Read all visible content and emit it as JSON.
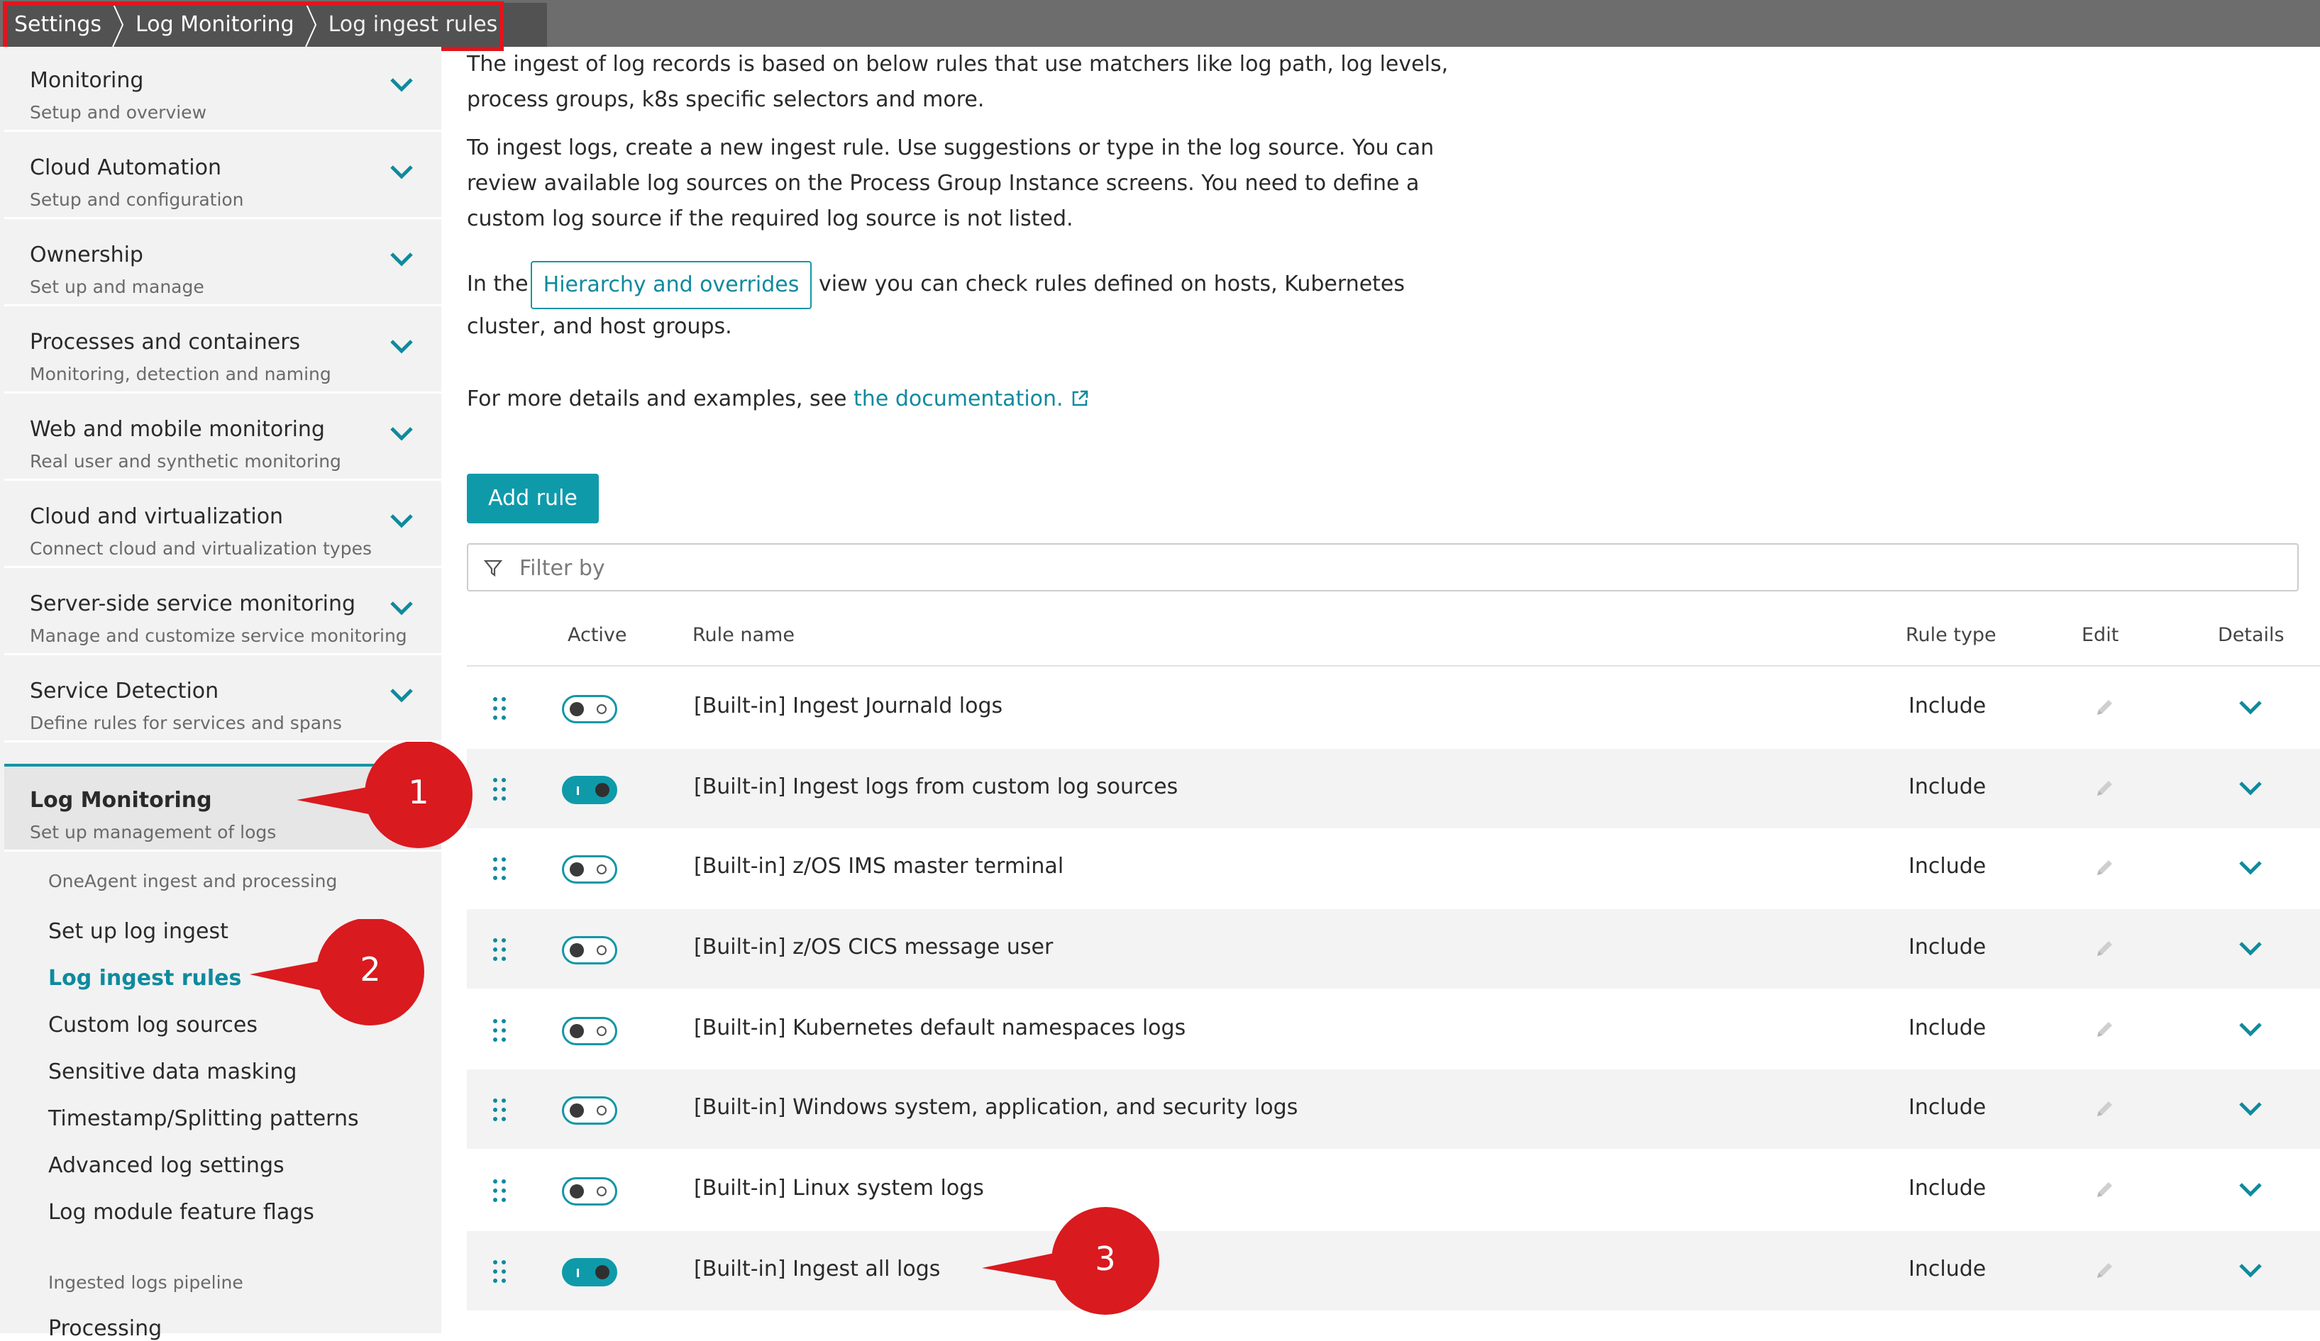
{
  "breadcrumb": [
    "Settings",
    "Log Monitoring",
    "Log ingest rules"
  ],
  "sidebar": {
    "groups": [
      {
        "title": "Monitoring",
        "subtitle": "Setup and overview"
      },
      {
        "title": "Cloud Automation",
        "subtitle": "Setup and configuration"
      },
      {
        "title": "Ownership",
        "subtitle": "Set up and manage"
      },
      {
        "title": "Processes and containers",
        "subtitle": "Monitoring, detection and naming"
      },
      {
        "title": "Web and mobile monitoring",
        "subtitle": "Real user and synthetic monitoring"
      },
      {
        "title": "Cloud and virtualization",
        "subtitle": "Connect cloud and virtualization types"
      },
      {
        "title": "Server-side service monitoring",
        "subtitle": "Manage and customize service monitoring"
      },
      {
        "title": "Service Detection",
        "subtitle": "Define rules for services and spans"
      },
      {
        "title": "Log Monitoring",
        "subtitle": "Set up management of logs"
      }
    ],
    "subnav": {
      "heading_oneagent": "OneAgent ingest and processing",
      "items": [
        "Set up log ingest",
        "Log ingest rules",
        "Custom log sources",
        "Sensitive data masking",
        "Timestamp/Splitting patterns",
        "Advanced log settings",
        "Log module feature flags"
      ],
      "heading_pipeline": "Ingested logs pipeline",
      "processing": "Processing"
    }
  },
  "main": {
    "intro_line1": "The ingest of log records is based on below rules that use matchers like log path, log levels,",
    "intro_line2": "process groups, k8s specific selectors and more.",
    "howto_line1": "To ingest logs, create a new ingest rule. Use suggestions or type in the log source. You can",
    "howto_line2": "review available log sources on the Process Group Instance screens. You need to define a",
    "howto_line3": "custom log source if the required log source is not listed.",
    "hier_prefix": "In the",
    "hier_button": "Hierarchy and overrides",
    "hier_suffix": "view you can check rules defined on hosts, Kubernetes",
    "hier_line2": "cluster, and host groups.",
    "docs_prefix": "For more details and examples, see",
    "docs_link": "the documentation.",
    "add_rule": "Add rule",
    "filter_placeholder": "Filter by"
  },
  "table": {
    "headers": {
      "active": "Active",
      "rule_name": "Rule name",
      "rule_type": "Rule type",
      "edit": "Edit",
      "details": "Details"
    },
    "rows": [
      {
        "name": "[Built-in] Ingest Journald logs",
        "type": "Include",
        "active": false
      },
      {
        "name": "[Built-in] Ingest logs from custom log sources",
        "type": "Include",
        "active": true
      },
      {
        "name": "[Built-in] z/OS IMS master terminal",
        "type": "Include",
        "active": false
      },
      {
        "name": "[Built-in] z/OS CICS message user",
        "type": "Include",
        "active": false
      },
      {
        "name": "[Built-in] Kubernetes default namespaces logs",
        "type": "Include",
        "active": false
      },
      {
        "name": "[Built-in] Windows system, application, and security logs",
        "type": "Include",
        "active": false
      },
      {
        "name": "[Built-in] Linux system logs",
        "type": "Include",
        "active": false
      },
      {
        "name": "[Built-in] Ingest all logs",
        "type": "Include",
        "active": true
      }
    ]
  },
  "annotations": [
    "1",
    "2",
    "3"
  ],
  "colors": {
    "accent": "#0f9aaa",
    "link": "#0f8a9d",
    "callout": "#d91a1f",
    "highlight_box": "#e0161c"
  }
}
